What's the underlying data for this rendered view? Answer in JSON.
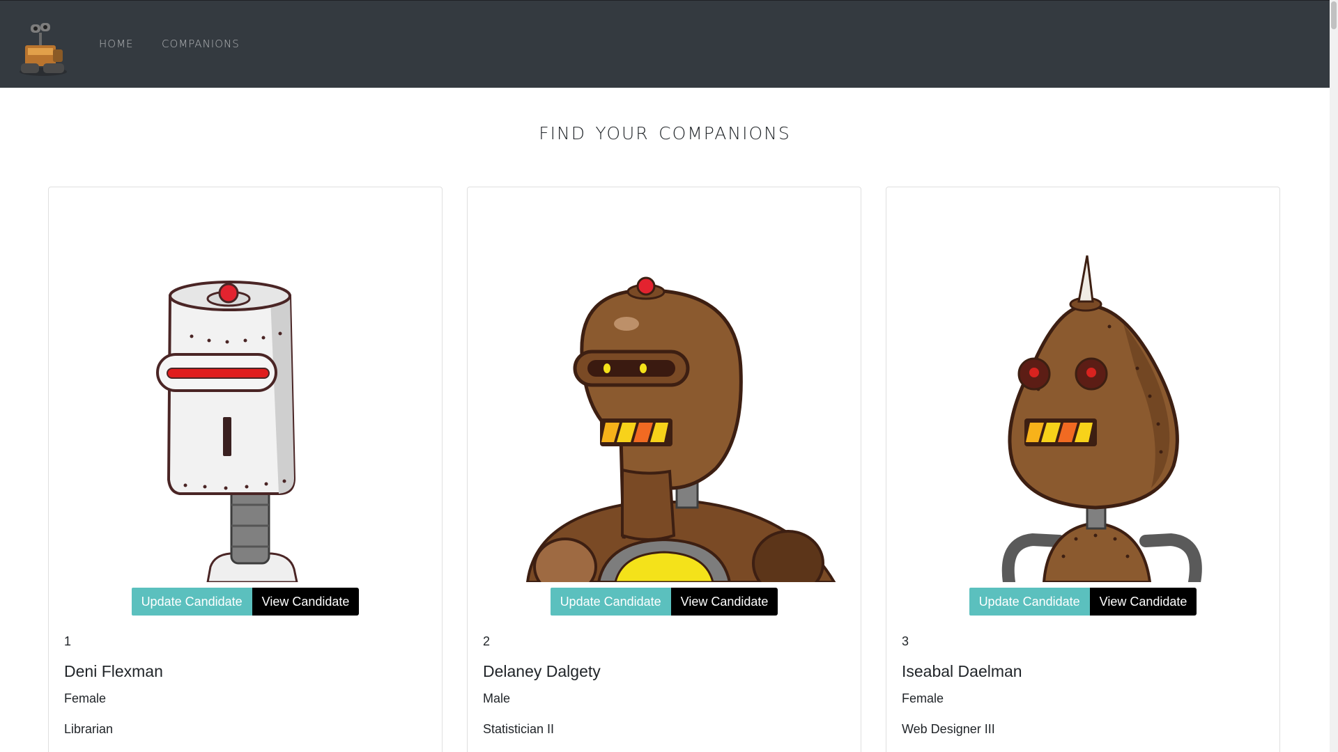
{
  "nav": {
    "home_label": "Home",
    "companions_label": "companions"
  },
  "page_title": "Find your companions",
  "buttons": {
    "update_label": "Update Candidate",
    "view_label": "View Candidate"
  },
  "candidates": [
    {
      "id": "1",
      "name": "Deni Flexman",
      "gender": "Female",
      "job": "Librarian",
      "robot": "white-box-robot"
    },
    {
      "id": "2",
      "name": "Delaney Dalgety",
      "gender": "Male",
      "job": "Statistician II",
      "robot": "brown-visor-robot"
    },
    {
      "id": "3",
      "name": "Iseabal Daelman",
      "gender": "Female",
      "job": "Web Designer III",
      "robot": "brown-spike-robot"
    }
  ],
  "colors": {
    "navbar": "#343a40",
    "update_button": "#5bc0be",
    "view_button": "#000000"
  }
}
